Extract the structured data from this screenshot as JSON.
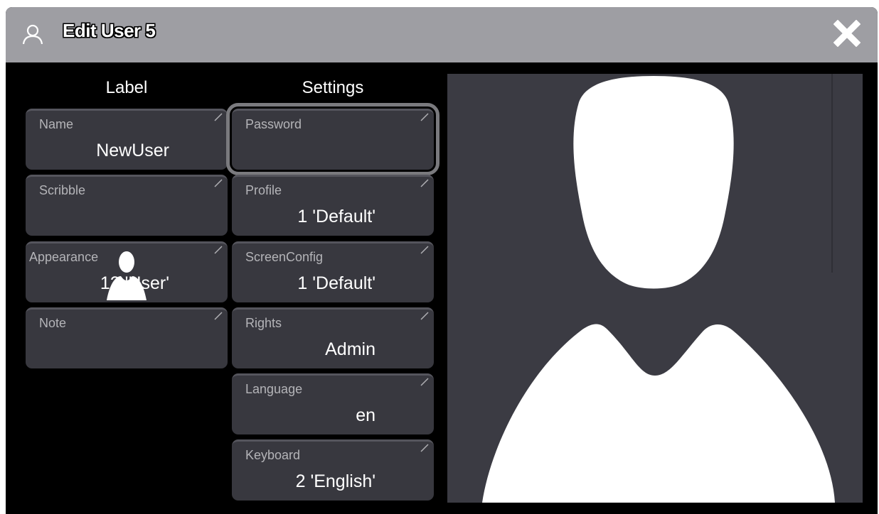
{
  "window": {
    "title": "Edit User 5",
    "user_icon": "user-icon",
    "close_icon": "close-icon"
  },
  "columns": {
    "label_header": "Label",
    "settings_header": "Settings"
  },
  "label_fields": [
    {
      "label": "Name",
      "value": "NewUser"
    },
    {
      "label": "Scribble",
      "value": ""
    },
    {
      "label": "Appearance",
      "value": "12 'User'",
      "icon": "user-silhouette-icon"
    },
    {
      "label": "Note",
      "value": ""
    }
  ],
  "settings_fields": [
    {
      "label": "Password",
      "value": "",
      "focused": true
    },
    {
      "label": "Profile",
      "value": "1 'Default'"
    },
    {
      "label": "ScreenConfig",
      "value": "1 'Default'"
    },
    {
      "label": "Rights",
      "value": "Admin"
    },
    {
      "label": "Language",
      "value": "en"
    },
    {
      "label": "Keyboard",
      "value": "2 'English'"
    }
  ],
  "preview": {
    "icon": "user-silhouette-icon"
  },
  "colors": {
    "titlebar": "#9e9ea3",
    "background": "#000000",
    "field": "#38383f",
    "preview": "#3b3b43",
    "focus_outline": "#7a7a7e"
  }
}
